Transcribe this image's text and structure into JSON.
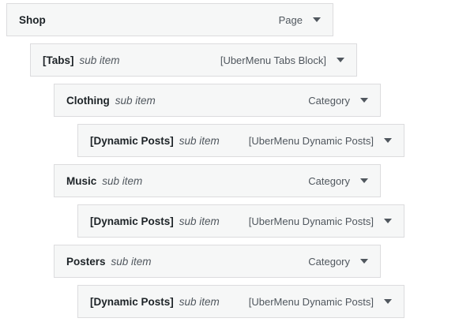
{
  "menu": {
    "items": [
      {
        "title": "Shop",
        "subtitle": "",
        "type": "Page"
      },
      {
        "title": "[Tabs]",
        "subtitle": "sub item",
        "type": "[UberMenu Tabs Block]"
      },
      {
        "title": "Clothing",
        "subtitle": "sub item",
        "type": "Category"
      },
      {
        "title": "[Dynamic Posts]",
        "subtitle": "sub item",
        "type": "[UberMenu Dynamic Posts]"
      },
      {
        "title": "Music",
        "subtitle": "sub item",
        "type": "Category"
      },
      {
        "title": "[Dynamic Posts]",
        "subtitle": "sub item",
        "type": "[UberMenu Dynamic Posts]"
      },
      {
        "title": "Posters",
        "subtitle": "sub item",
        "type": "Category"
      },
      {
        "title": "[Dynamic Posts]",
        "subtitle": "sub item",
        "type": "[UberMenu Dynamic Posts]"
      }
    ]
  },
  "icons": {
    "toggle": "caret-down-icon"
  },
  "colors": {
    "item_background": "#f6f7f7",
    "item_border": "#dcdcde",
    "title_text": "#1d2327",
    "secondary_text": "#50575e"
  }
}
